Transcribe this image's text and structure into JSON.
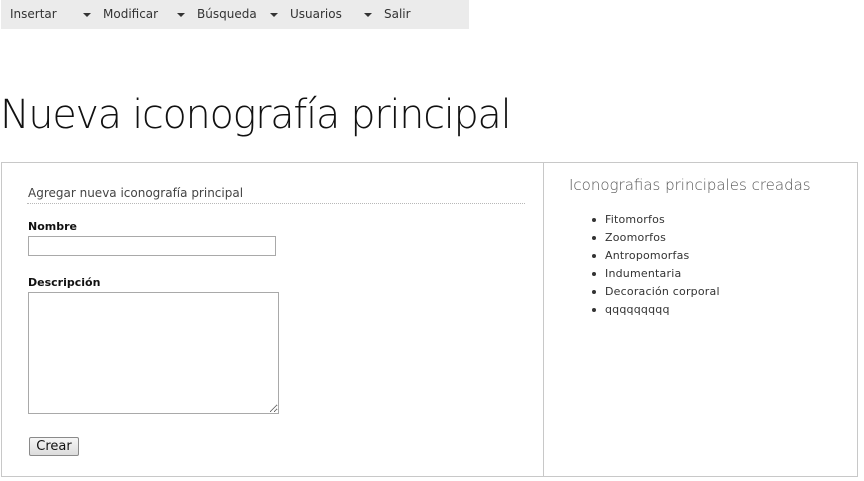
{
  "menu": {
    "items": [
      {
        "label": "Insertar",
        "has_dropdown": true
      },
      {
        "label": "Modificar",
        "has_dropdown": true
      },
      {
        "label": "Búsqueda",
        "has_dropdown": true
      },
      {
        "label": "Usuarios",
        "has_dropdown": true
      },
      {
        "label": "Salir",
        "has_dropdown": false
      }
    ]
  },
  "page": {
    "title": "Nueva iconografía principal"
  },
  "form": {
    "legend": "Agregar nueva iconografía principal",
    "nombre_label": "Nombre",
    "nombre_value": "",
    "descripcion_label": "Descripción",
    "descripcion_value": "",
    "submit_label": "Crear"
  },
  "sidebar": {
    "heading": "Iconografias principales creadas",
    "items": [
      "Fitomorfos",
      "Zoomorfos",
      "Antropomorfas",
      "Indumentaria",
      "Decoración corporal",
      "qqqqqqqqq"
    ]
  },
  "colors": {
    "menu_background": "#ebebeb",
    "border": "#c8c8c8",
    "text": "#222222"
  },
  "icons": {
    "dropdown": "caret-down-icon",
    "list_bullet": "bullet-icon"
  }
}
